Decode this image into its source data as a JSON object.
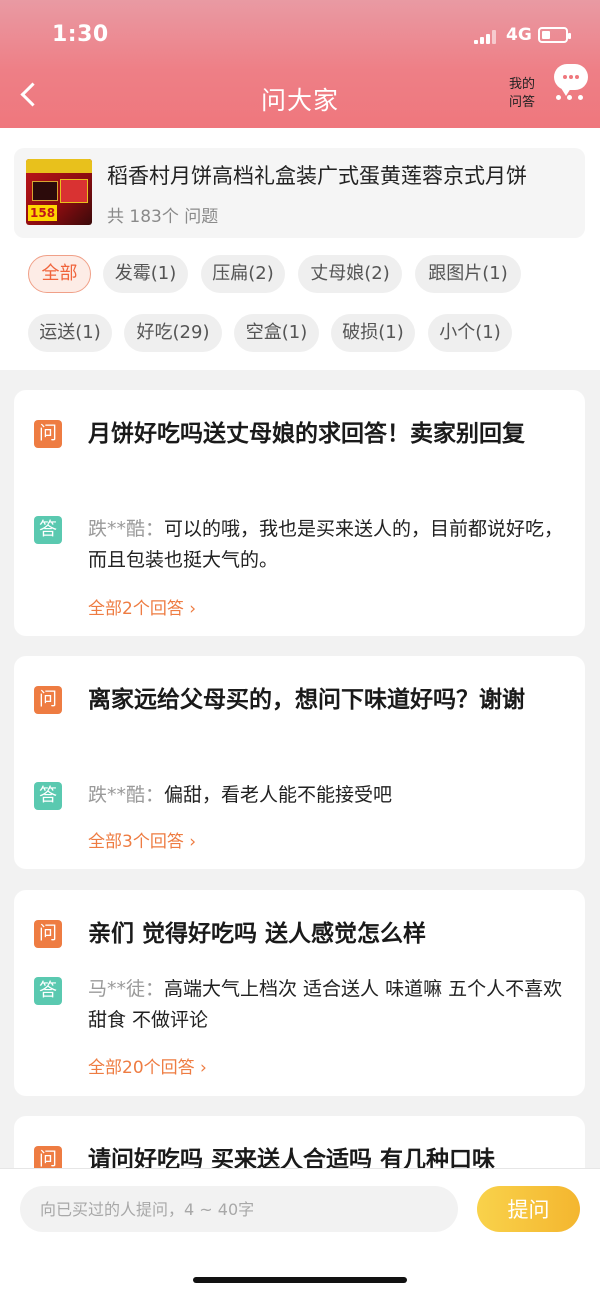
{
  "status_bar": {
    "time": "1:30",
    "network": "4G",
    "battery_level": 0.35
  },
  "nav": {
    "title": "问大家",
    "my_qa_label": "我的\n问答",
    "icons": [
      "back-arrow-icon",
      "chat-bubble-icon",
      "more-icon"
    ]
  },
  "product": {
    "title": "稻香村月饼高档礼盒装广式蛋黄莲蓉京式月饼",
    "question_count": "共 183个 问题",
    "thumb_price": "158"
  },
  "tags": [
    "全部",
    "发霉(1)",
    "压扁(2)",
    "丈母娘(2)",
    "跟图片(1)",
    "运送(1)",
    "好吃(29)",
    "空盒(1)",
    "破损(1)",
    "小个(1)"
  ],
  "selected_tag": "全部",
  "qa_list": [
    {
      "q_badge": "问",
      "question": "月饼好吃吗送丈母娘的求回答！卖家别回复",
      "a_badge": "答",
      "answer_user": "跌**酷：",
      "answer": "可以的哦，我也是买来送人的，目前都说好吃，而且包装也挺大气的。",
      "more_label": "全部2个回答"
    },
    {
      "q_badge": "问",
      "question": "离家远给父母买的，想问下味道好吗？谢谢",
      "a_badge": "答",
      "answer_user": "跌**酷：",
      "answer": "偏甜，看老人能不能接受吧",
      "more_label": "全部3个回答"
    },
    {
      "q_badge": "问",
      "question": "亲们  觉得好吃吗 送人感觉怎么样",
      "a_badge": "答",
      "answer_user": "马**徒：",
      "answer": "高端大气上档次 适合送人  味道嘛 五个人不喜欢甜食 不做评论",
      "more_label": "全部20个回答"
    },
    {
      "q_badge": "问",
      "question": "请问好吃吗 买来送人合适吗 有几种口味"
    }
  ],
  "ask": {
    "placeholder": "向已买过的人提问，4 ~ 40字",
    "button_label": "提问"
  },
  "colors": {
    "header": "#ef777d",
    "accent": "#ee7c42",
    "answer_badge": "#5ac9b0",
    "ask_button": "#f4b62f"
  }
}
